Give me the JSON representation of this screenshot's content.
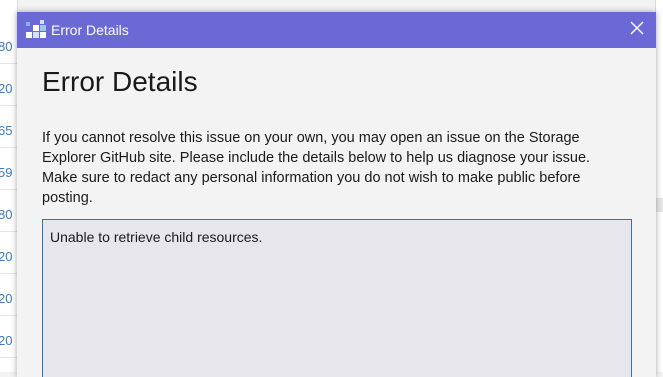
{
  "background": {
    "left_rows": [
      "80",
      "20",
      "65",
      "59",
      "80",
      "20",
      "20",
      "20"
    ]
  },
  "dialog": {
    "window_title": "Error Details",
    "heading": "Error Details",
    "description": "If you cannot resolve this issue on your own, you may open an issue on the Storage Explorer GitHub site. Please include the details below to help us diagnose your issue. Make sure to redact any personal information you do not wish to make public before posting.",
    "details_text": "Unable to retrieve child resources.",
    "close_icon": "close-icon",
    "app_icon": "storage-explorer-icon"
  },
  "colors": {
    "titlebar": "#6b69d6",
    "details_border": "#2e6fc3",
    "details_background": "#e8e6ed",
    "link_text": "#3b79c5"
  }
}
